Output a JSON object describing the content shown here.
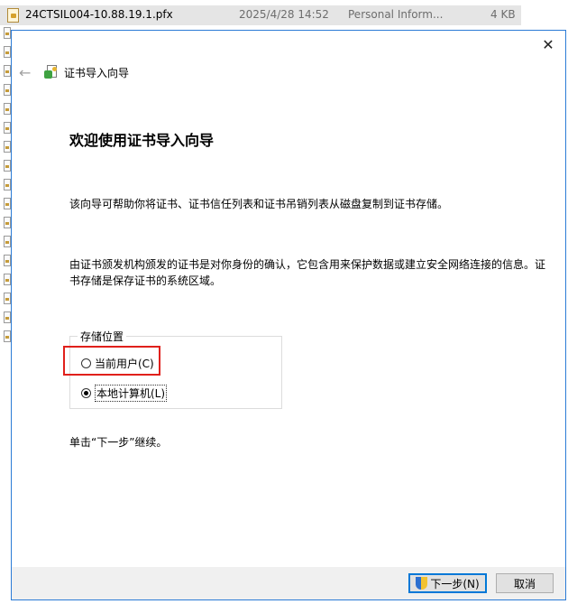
{
  "explorer": {
    "file_name": "24CTSIL004-10.88.19.1.pfx",
    "file_date": "2025/4/28 14:52",
    "file_type": "Personal Inform...",
    "file_size": "4 KB"
  },
  "dialog": {
    "close_glyph": "✕",
    "back_glyph": "←",
    "nav_title": "证书导入向导",
    "heading": "欢迎使用证书导入向导",
    "para1": "该向导可帮助你将证书、证书信任列表和证书吊销列表从磁盘复制到证书存储。",
    "para2": "由证书颁发机构颁发的证书是对你身份的确认，它包含用来保护数据或建立安全网络连接的信息。证书存储是保存证书的系统区域。",
    "store_location": {
      "legend": "存储位置",
      "options": [
        {
          "label": "当前用户(C)",
          "selected": false
        },
        {
          "label": "本地计算机(L)",
          "selected": true
        }
      ]
    },
    "continue_text": "单击“下一步”继续。",
    "buttons": {
      "next": "下一步(N)",
      "cancel": "取消"
    }
  },
  "colors": {
    "dialog_border": "#2b7bd6",
    "highlight": "#e0201b",
    "default_button_border": "#0078d7"
  },
  "icons": [
    "file-pfx-icon",
    "back-arrow-icon",
    "certificate-wizard-icon",
    "close-icon",
    "uac-shield-icon"
  ]
}
